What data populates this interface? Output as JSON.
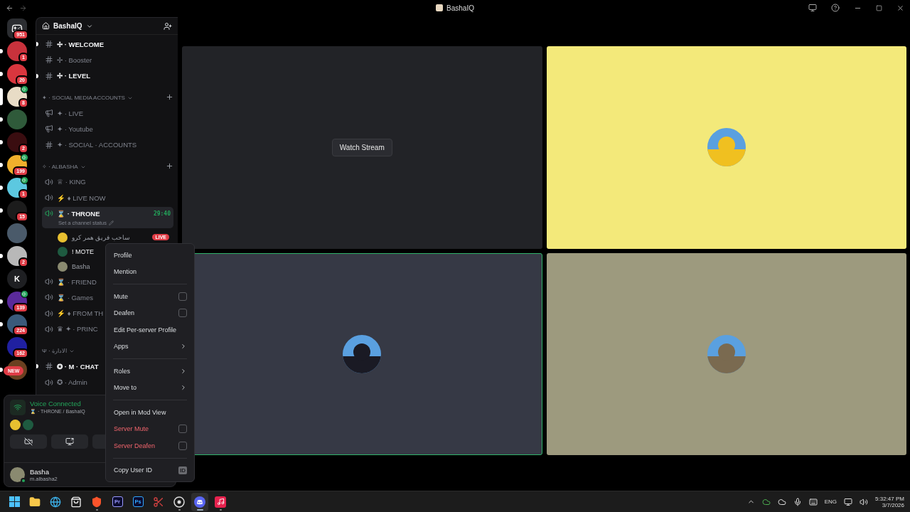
{
  "window": {
    "title": "BashaIQ"
  },
  "servers": [
    {
      "kind": "home",
      "badge": "951",
      "unread": false,
      "selected": false,
      "speaker": false
    },
    {
      "kind": "image",
      "color": "#c8323c",
      "badge": "1",
      "unread": true,
      "selected": false,
      "speaker": false
    },
    {
      "kind": "image",
      "color": "#d9363e",
      "badge": "20",
      "unread": true,
      "selected": false,
      "speaker": false
    },
    {
      "kind": "image",
      "color": "#e8dcc6",
      "badge": "8",
      "unread": false,
      "selected": true,
      "speaker": true
    },
    {
      "kind": "image",
      "color": "#2f5a3a",
      "unread": true,
      "selected": false,
      "speaker": false
    },
    {
      "kind": "image",
      "color": "#3a0d10",
      "badge": "2",
      "unread": true,
      "selected": false,
      "speaker": false
    },
    {
      "kind": "image",
      "color": "#f0b02c",
      "badge": "199",
      "unread": true,
      "selected": false,
      "speaker": true
    },
    {
      "kind": "image",
      "color": "#5cc8e0",
      "badge": "1",
      "unread": true,
      "selected": false,
      "speaker": true
    },
    {
      "kind": "image",
      "color": "#1c1c1c",
      "badge": "15",
      "unread": true,
      "selected": false,
      "speaker": false
    },
    {
      "kind": "image",
      "color": "#4a5a6a",
      "unread": false,
      "selected": false,
      "speaker": false
    },
    {
      "kind": "image",
      "color": "#b8b8b8",
      "badge": "2",
      "unread": true,
      "selected": false,
      "speaker": false
    },
    {
      "kind": "letter",
      "letter": "K",
      "unread": false,
      "selected": false,
      "speaker": false
    },
    {
      "kind": "image",
      "color": "#5a2a9a",
      "badge": "139",
      "unread": true,
      "selected": false,
      "speaker": true
    },
    {
      "kind": "image",
      "color": "#3a5a7a",
      "badge": "224",
      "unread": true,
      "selected": false,
      "speaker": false
    },
    {
      "kind": "image",
      "color": "#2020a0",
      "badge": "162",
      "unread": false,
      "selected": false,
      "speaker": false
    },
    {
      "kind": "image",
      "color": "#6a4020",
      "pill": "NEW",
      "unread": true,
      "selected": false,
      "speaker": false
    }
  ],
  "server": {
    "name": "BashaIQ"
  },
  "channels": [
    {
      "kind": "text",
      "name": "✢ · WELCOME",
      "unread": true
    },
    {
      "kind": "text",
      "name": "✢ · Booster",
      "unread": false
    },
    {
      "kind": "text",
      "name": "✢ · LEVEL",
      "unread": true
    },
    {
      "kind": "category",
      "name": "✦ · SOCIAL MEDIA ACCOUNTS",
      "can_add": true
    },
    {
      "kind": "announcement",
      "name": "✦ · LIVE",
      "unread": false
    },
    {
      "kind": "announcement",
      "name": "✦ · Youtube",
      "unread": false
    },
    {
      "kind": "text",
      "name": "✦ · SOCIAL · ACCOUNTS",
      "unread": false
    },
    {
      "kind": "category",
      "name": "✧ · ALBASHA",
      "can_add": true
    },
    {
      "kind": "voice",
      "name": "♕ · KING",
      "unread": false
    },
    {
      "kind": "voice",
      "name": "⚡ ♦ LIVE NOW",
      "unread": false
    },
    {
      "kind": "voice",
      "name": "⌛ · THRONE",
      "unread": true,
      "selected": true,
      "timer": "29:40",
      "status": "Set a channel status",
      "members": [
        {
          "name": "ساحب فريق همر كرو",
          "badge": "LIVE",
          "active": false,
          "color": "#e8c030"
        },
        {
          "name": "! MOTE",
          "active": true,
          "color": "#1e5a40"
        },
        {
          "name": "Basha",
          "active": false,
          "color": "#8a8a70"
        }
      ]
    },
    {
      "kind": "voice",
      "name": "⌛ · FRIEND",
      "unread": false
    },
    {
      "kind": "voice",
      "name": "⌛ · Games",
      "unread": false
    },
    {
      "kind": "voice",
      "name": "⚡ ♦ FROM TH",
      "unread": false
    },
    {
      "kind": "voice",
      "name": "♛ ✦ · PRINC",
      "unread": false
    },
    {
      "kind": "category",
      "name": "Ψ · الادارة",
      "can_add": false
    },
    {
      "kind": "text",
      "name": "✪ · **M** · CHAT",
      "unread": true
    },
    {
      "kind": "voice",
      "name": "✪ · Admin",
      "unread": false
    }
  ],
  "voice_panel": {
    "status": "Voice Connected",
    "channel": "⌛ · THRONE / BashaIQ",
    "participants": [
      {
        "color": "#e8c030"
      },
      {
        "color": "#1e5a40"
      }
    ],
    "buttons": [
      {
        "kind": "camera-off"
      },
      {
        "kind": "screen-share"
      },
      {
        "kind": "activity"
      }
    ]
  },
  "user": {
    "name": "Basha",
    "status_text": "m.albasha2",
    "online": true
  },
  "tiles": [
    {
      "kind": "stream",
      "button": "Watch Stream",
      "speaking": false
    },
    {
      "kind": "avatar",
      "color": "#f3e97a",
      "avatar": {
        "color": "#f0c020"
      },
      "speaking": false
    },
    {
      "kind": "avatar",
      "color": "#363945",
      "avatar": {
        "color": "#1a1a24"
      },
      "speaking": true
    },
    {
      "kind": "avatar",
      "color": "#9d9a7e",
      "avatar": {
        "color": "#7a6a50"
      },
      "speaking": false
    }
  ],
  "menu": {
    "groups": [
      [
        {
          "label": "Profile",
          "kind": "plain",
          "danger": false
        },
        {
          "label": "Mention",
          "kind": "plain",
          "danger": false
        }
      ],
      [
        {
          "label": "Mute",
          "kind": "checkbox",
          "checked": false,
          "danger": false
        },
        {
          "label": "Deafen",
          "kind": "checkbox",
          "checked": false,
          "danger": false
        },
        {
          "label": "Edit Per-server Profile",
          "kind": "plain",
          "danger": false
        },
        {
          "label": "Apps",
          "kind": "submenu",
          "danger": false
        }
      ],
      [
        {
          "label": "Roles",
          "kind": "submenu",
          "danger": false
        },
        {
          "label": "Move to",
          "kind": "submenu",
          "danger": false
        }
      ],
      [
        {
          "label": "Open in Mod View",
          "kind": "plain",
          "danger": false
        },
        {
          "label": "Server Mute",
          "kind": "checkbox",
          "checked": false,
          "danger": true
        },
        {
          "label": "Server Deafen",
          "kind": "checkbox",
          "checked": false,
          "danger": true
        }
      ],
      [
        {
          "label": "Copy User ID",
          "kind": "id",
          "tag": "ID",
          "danger": false
        }
      ]
    ]
  },
  "taskbar": {
    "apps": [
      {
        "kind": "start",
        "running": false,
        "selected": false
      },
      {
        "kind": "folder",
        "running": false,
        "selected": false
      },
      {
        "kind": "edge",
        "running": false,
        "selected": false
      },
      {
        "kind": "store",
        "running": false,
        "selected": false
      },
      {
        "kind": "brave",
        "running": true,
        "selected": false
      },
      {
        "kind": "letters",
        "label": "Pr",
        "color": "#9999ff",
        "running": false,
        "selected": false
      },
      {
        "kind": "letters",
        "label": "Ps",
        "color": "#31a8ff",
        "running": false,
        "selected": false
      },
      {
        "kind": "snip",
        "running": false,
        "selected": false
      },
      {
        "kind": "obs",
        "running": true,
        "selected": false
      },
      {
        "kind": "discord",
        "running": true,
        "selected": true
      },
      {
        "kind": "tiktok",
        "running": true,
        "selected": false
      }
    ],
    "language": "ENG",
    "time": "5:32:47 PM",
    "date": "3/7/2026"
  }
}
